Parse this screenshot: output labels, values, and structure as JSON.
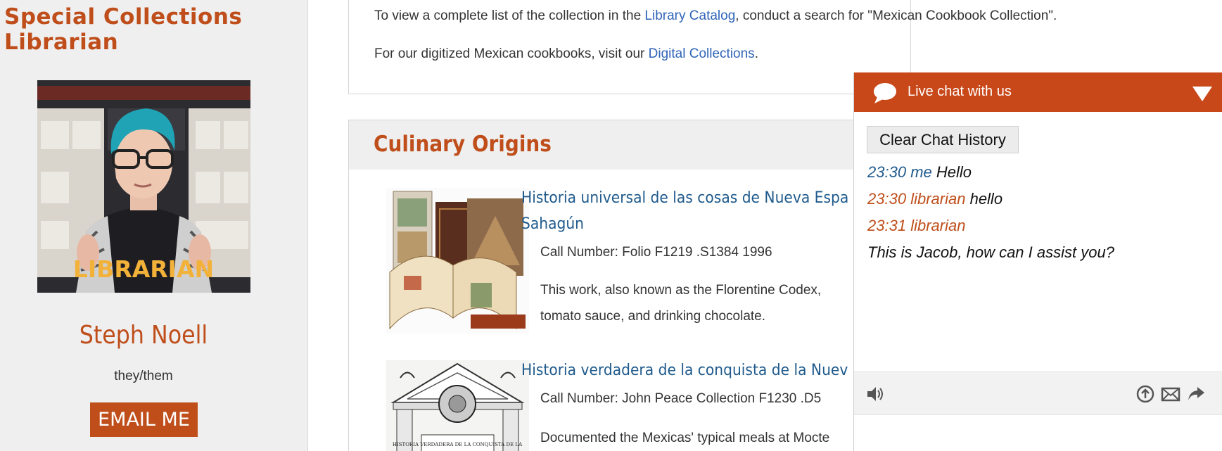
{
  "sidebar": {
    "title": "Special Collections Librarian",
    "photo_alt": "LIBRARIAN",
    "name": "Steph Noell",
    "pronouns": "they/them",
    "email_label": "EMAIL ME"
  },
  "intro": {
    "p1_before": "To view a complete list of the collection in the ",
    "p1_link": "Library Catalog",
    "p1_after": ", conduct a search for \"Mexican Cookbook Collection\".",
    "p2_before": "For our digitized Mexican cookbooks, visit our ",
    "p2_link": "Digital Collections",
    "p2_after": "."
  },
  "section": {
    "title": "Culinary Origins",
    "items": [
      {
        "title_line1": "Historia universal de las cosas de Nueva Espa",
        "title_line2": "Sahagún",
        "call_number": "Call Number: Folio F1219 .S1384 1996",
        "desc_line1": "This work, also known as the Florentine Codex,",
        "desc_line2": "tomato sauce, and drinking chocolate."
      },
      {
        "title_line1": "Historia verdadera de la conquista de la Nuev",
        "call_number": "Call Number: John Peace Collection F1230 .D5",
        "desc_line1": "Documented the Mexicas' typical meals at Mocte",
        "thumb_caption": "HISTORIA VERDADERA DE LA CONQUISTA DE LA"
      }
    ]
  },
  "chat": {
    "header_title": "Live chat with us",
    "clear_label": "Clear Chat History",
    "messages": [
      {
        "time": "23:30",
        "sender": "me",
        "text": "Hello"
      },
      {
        "time": "23:30",
        "sender": "librarian",
        "text": "hello"
      },
      {
        "time": "23:31",
        "sender": "librarian",
        "text": ""
      },
      {
        "time": "",
        "sender": "",
        "text": "This is Jacob, how can I assist you?"
      }
    ],
    "colors": {
      "header": "#c9481a",
      "me": "#1f5a8c",
      "librarian": "#bf4e1b"
    },
    "footer_icons": [
      "speaker-icon",
      "upload-icon",
      "email-icon",
      "share-icon"
    ]
  },
  "colors": {
    "accent": "#bf4e1b",
    "link": "#2f64b8",
    "item_title": "#1f5a8c",
    "sidebar_bg": "#efefef"
  }
}
